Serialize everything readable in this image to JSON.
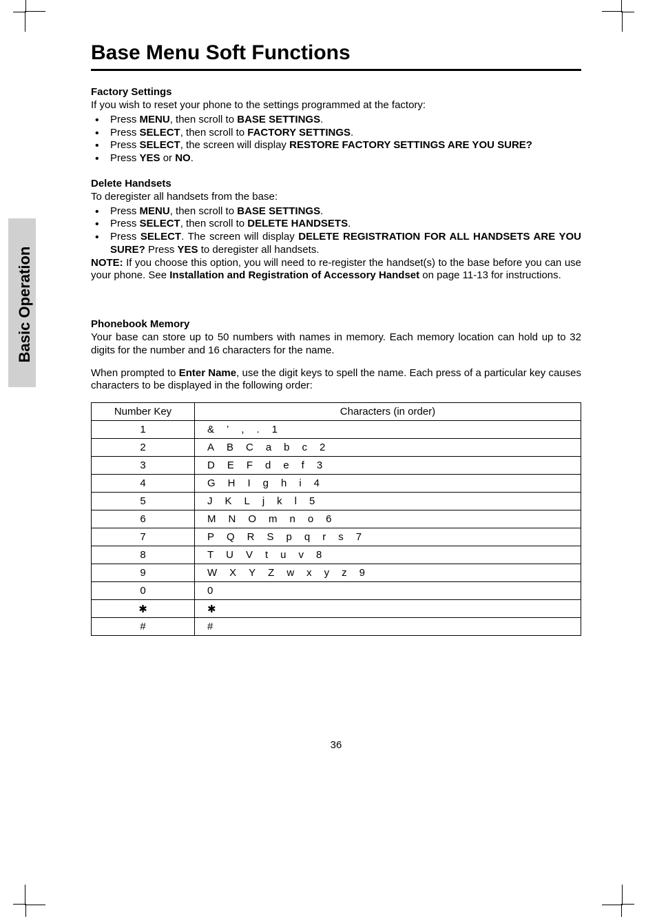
{
  "title": "Base Menu Soft Functions",
  "side_label": "Basic Operation",
  "page_number": "36",
  "s1": {
    "heading": "Factory Settings",
    "intro": "If you wish to reset your phone to the settings programmed at the factory:",
    "b1_pre": "Press ",
    "b1_k1": "MENU",
    "b1_mid": ", then scroll to ",
    "b1_k2": "BASE SETTINGS",
    "b1_end": ".",
    "b2_pre": "Press ",
    "b2_k1": "SELECT",
    "b2_mid": ", then scroll to ",
    "b2_k2": "FACTORY SETTINGS",
    "b2_end": ".",
    "b3_pre": "Press ",
    "b3_k1": "SELECT",
    "b3_mid": ", the screen will display ",
    "b3_k2": "RESTORE FACTORY SETTINGS  ARE YOU SURE?",
    "b4_pre": "Press ",
    "b4_k1": "YES",
    "b4_mid": " or ",
    "b4_k2": "NO",
    "b4_end": "."
  },
  "s2": {
    "heading": "Delete Handsets",
    "intro": "To deregister all handsets from the base:",
    "b1_pre": "Press ",
    "b1_k1": "MENU",
    "b1_mid": ", then scroll to ",
    "b1_k2": "BASE SETTINGS",
    "b1_end": ".",
    "b2_pre": "Press ",
    "b2_k1": "SELECT",
    "b2_mid": ", then scroll to ",
    "b2_k2": "DELETE HANDSETS",
    "b2_end": ".",
    "b3_pre": "Press ",
    "b3_k1": "SELECT",
    "b3_mid": ". The screen will display ",
    "b3_k2": "DELETE REGISTRATION FOR ALL HANDSETS ARE YOU SURE?",
    "b3_aft": " Press ",
    "b3_k3": "YES",
    "b3_end": " to deregister all handsets.",
    "note_label": "NOTE:",
    "note_text": " If you choose this option, you will need to re-register the handset(s) to the base before you can use your phone. See ",
    "note_bold": "Installation and Registration of Accessory Handset",
    "note_after": " on page 11-13 for instructions."
  },
  "s3": {
    "heading": "Phonebook Memory",
    "p1": "Your base can store up to 50 numbers with names in memory. Each memory location can hold up to 32 digits for the number and 16 characters for the name.",
    "p2_pre": "When prompted to ",
    "p2_bold": "Enter Name",
    "p2_after": ", use the digit keys to spell the name. Each press of a particular key causes characters to be displayed in the following order:"
  },
  "table": {
    "head_key": "Number Key",
    "head_chars": "Characters  (in order)",
    "rows": [
      {
        "key": "1",
        "chars": "& ’ , . 1"
      },
      {
        "key": "2",
        "chars": "A B C a b c 2"
      },
      {
        "key": "3",
        "chars": "D E F d e f 3"
      },
      {
        "key": "4",
        "chars": "G H I g h i 4"
      },
      {
        "key": "5",
        "chars": "J K L j k l 5"
      },
      {
        "key": "6",
        "chars": "M N O m n o 6"
      },
      {
        "key": "7",
        "chars": "P Q R S p q r s 7"
      },
      {
        "key": "8",
        "chars": "T U V t u v 8"
      },
      {
        "key": "9",
        "chars": "W X Y Z w x y z 9"
      },
      {
        "key": "0",
        "chars": "0"
      },
      {
        "key": "✱",
        "chars": "✱"
      },
      {
        "key": "#",
        "chars": "#"
      }
    ]
  }
}
